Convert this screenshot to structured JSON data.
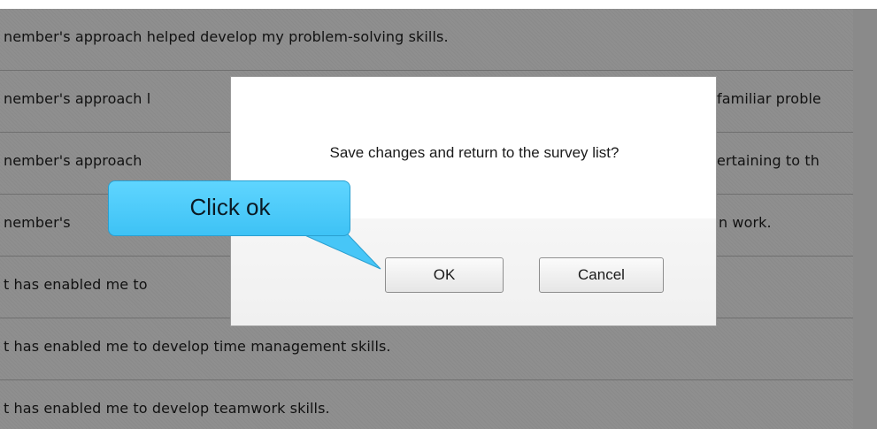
{
  "survey": {
    "rows": [
      "nember's approach helped develop my problem-solving skills.",
      "nember's approach l",
      "nember's approach",
      "nember's",
      "t has enabled me to",
      "t has enabled me to develop time management skills.",
      "t has enabled me to develop teamwork skills."
    ],
    "rows_visible_right": [
      "",
      "familiar proble",
      "ertaining to th",
      "n work.",
      "",
      "",
      ""
    ]
  },
  "dialog": {
    "message": "Save changes and return to the survey list?",
    "ok_label": "OK",
    "cancel_label": "Cancel"
  },
  "callout": {
    "text": "Click ok",
    "color": "#4cc9fb"
  },
  "colors": {
    "overlay": "#8f8f8f",
    "dialog_bg": "#ffffff",
    "footer_bg": "#f2f2f2"
  }
}
